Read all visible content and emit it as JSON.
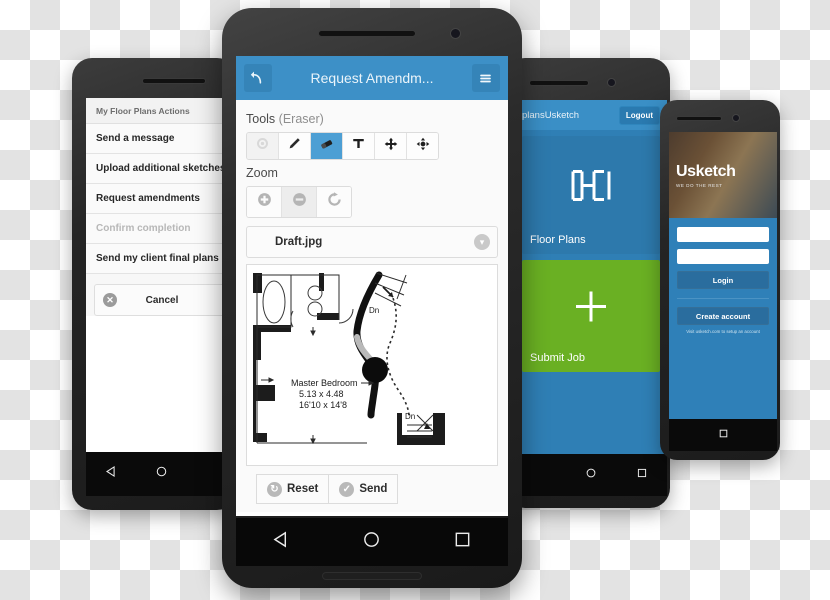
{
  "scene": {
    "background": "transparency-checkerboard",
    "checker_colors": [
      "#ffffff",
      "#e3e3e3"
    ]
  },
  "front_phone": {
    "header": {
      "back_icon": "back-arrow-icon",
      "title": "Request Amendm...",
      "menu_icon": "hamburger-menu-icon"
    },
    "tools_section": {
      "label": "Tools",
      "sub_label": "(Eraser)",
      "buttons": [
        {
          "name": "settings-tool",
          "icon": "gear-icon",
          "state": "disabled"
        },
        {
          "name": "pencil-tool",
          "icon": "pencil-icon",
          "state": "normal"
        },
        {
          "name": "eraser-tool",
          "icon": "eraser-icon",
          "state": "active"
        },
        {
          "name": "text-tool",
          "icon": "text-t-icon",
          "state": "normal"
        },
        {
          "name": "move-tool",
          "icon": "move-arrows-icon",
          "state": "normal"
        },
        {
          "name": "rotate-tool",
          "icon": "rotate-handles-icon",
          "state": "normal"
        }
      ]
    },
    "zoom_section": {
      "label": "Zoom",
      "buttons": [
        {
          "name": "zoom-in-button",
          "icon": "plus-circle-icon",
          "state": "normal"
        },
        {
          "name": "zoom-out-button",
          "icon": "minus-circle-icon",
          "state": "pressed"
        },
        {
          "name": "zoom-reset-button",
          "icon": "refresh-circle-icon",
          "state": "normal"
        }
      ]
    },
    "file_select": {
      "value": "Draft.jpg",
      "chevron_icon": "chevron-down-icon"
    },
    "canvas": {
      "label": "floor-plan-canvas",
      "room_label": "Master Bedroom",
      "dimensions_metric": "5.13 x 4.48",
      "dimensions_imperial": "16'10 x 14'8",
      "stair_labels": [
        "Dn",
        "Dn"
      ]
    },
    "footer": {
      "reset_label": "Reset",
      "reset_icon": "refresh-circle-icon",
      "send_label": "Send",
      "send_icon": "check-circle-icon"
    },
    "navbar": {
      "back_icon": "nav-back-triangle-icon",
      "home_icon": "nav-home-circle-icon",
      "recents_icon": "nav-recents-square-icon"
    },
    "accent_color": "#3d90c7"
  },
  "left_phone": {
    "sheet": {
      "title": "My Floor Plans Actions",
      "items": [
        {
          "label": "Send a message",
          "state": "enabled"
        },
        {
          "label": "Upload additional sketches",
          "state": "enabled"
        },
        {
          "label": "Request amendments",
          "state": "enabled"
        },
        {
          "label": "Confirm completion",
          "state": "disabled"
        },
        {
          "label": "Send my client final plans",
          "state": "enabled"
        }
      ],
      "cancel_label": "Cancel",
      "cancel_icon": "close-circle-icon"
    },
    "navbar": {
      "back_icon": "nav-back-triangle-icon",
      "home_icon": "nav-home-circle-icon"
    }
  },
  "mid_right_phone": {
    "header": {
      "brand": "plansUsketch",
      "logout_label": "Logout"
    },
    "tiles": [
      {
        "label": "Floor Plans",
        "icon": "floor-plan-icon",
        "color": "#2d79ac"
      },
      {
        "label": "Submit Job",
        "icon": "plus-icon",
        "color": "#6ab023"
      }
    ],
    "background_color": "#2f7fb5",
    "navbar": {
      "home_icon": "nav-home-circle-icon",
      "recents_icon": "nav-recents-square-icon"
    }
  },
  "far_right_phone": {
    "hero": {
      "logo": "Usketch",
      "tagline": "WE DO THE REST"
    },
    "form": {
      "username_value": "",
      "username_placeholder": "",
      "password_value": "",
      "password_placeholder": "",
      "login_label": "Login",
      "create_account_label": "Create account",
      "note": "Visit usketch.com to setup an account"
    },
    "background_color": "#2f80b8",
    "navbar": {
      "home_icon": "nav-home-circle-icon"
    }
  }
}
